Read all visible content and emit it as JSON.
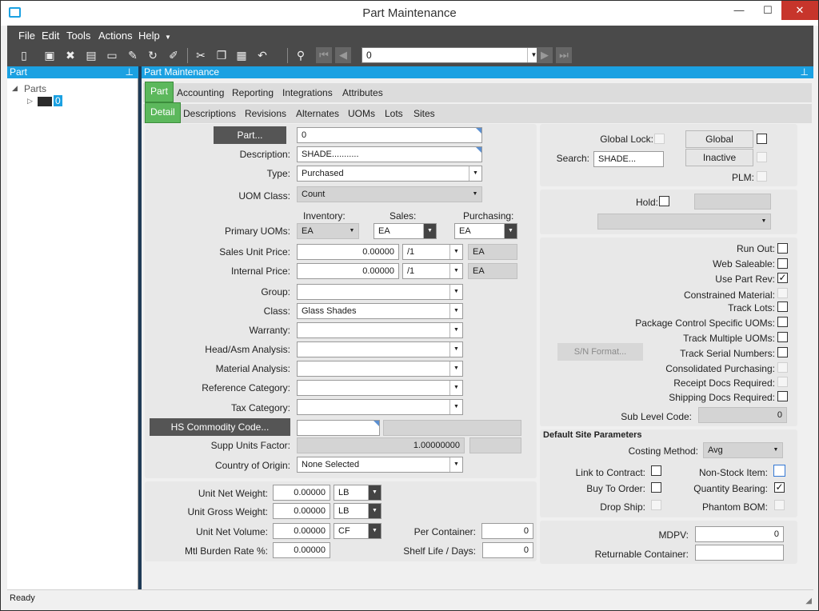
{
  "window": {
    "title": "Part Maintenance",
    "min": "—",
    "max": "☐",
    "close": "✕"
  },
  "menu": [
    "File",
    "Edit",
    "Tools",
    "Actions",
    "Help"
  ],
  "toolbar": {
    "record_value": "0"
  },
  "left_panel": {
    "header": "Part",
    "pin": "⊥",
    "tree_root": "Parts",
    "tree_child": "0"
  },
  "main_panel": {
    "header": "Part Maintenance",
    "pin": "⊥"
  },
  "tabs_top": [
    "Part",
    "Accounting",
    "Reporting",
    "Integrations",
    "Attributes"
  ],
  "tabs_sub": [
    "Detail",
    "Descriptions",
    "Revisions",
    "Alternates",
    "UOMs",
    "Lots",
    "Sites"
  ],
  "form": {
    "part_button": "Part...",
    "part_value": "0",
    "description_label": "Description:",
    "description_value": "SHADE...........",
    "type_label": "Type:",
    "type_value": "Purchased",
    "uom_class_label": "UOM Class:",
    "uom_class_value": "Count",
    "inventory_label": "Inventory:",
    "sales_label": "Sales:",
    "purchasing_label": "Purchasing:",
    "primary_uoms_label": "Primary UOMs:",
    "inv_uom": "EA",
    "sales_uom": "EA",
    "purch_uom": "EA",
    "sales_unit_price_label": "Sales Unit Price:",
    "sales_unit_price": "0.00000",
    "sales_per": "/1",
    "sales_price_uom": "EA",
    "internal_price_label": "Internal Price:",
    "internal_price": "0.00000",
    "internal_per": "/1",
    "internal_price_uom": "EA",
    "group_label": "Group:",
    "group_value": "",
    "class_label": "Class:",
    "class_value": "Glass Shades",
    "warranty_label": "Warranty:",
    "headasm_label": "Head/Asm Analysis:",
    "material_label": "Material Analysis:",
    "refcat_label": "Reference Category:",
    "taxcat_label": "Tax Category:",
    "hs_button": "HS Commodity Code...",
    "supp_units_label": "Supp Units Factor:",
    "supp_units_value": "1.00000000",
    "country_label": "Country of Origin:",
    "country_value": "None Selected",
    "unit_net_weight_label": "Unit Net Weight:",
    "unit_net_weight": "0.00000",
    "net_weight_uom": "LB",
    "unit_gross_weight_label": "Unit Gross Weight:",
    "unit_gross_weight": "0.00000",
    "gross_weight_uom": "LB",
    "unit_net_volume_label": "Unit Net Volume:",
    "unit_net_volume": "0.00000",
    "volume_uom": "CF",
    "mtl_burden_label": "Mtl Burden Rate %:",
    "mtl_burden": "0.00000",
    "per_container_label": "Per Container:",
    "per_container": "0",
    "shelf_life_label": "Shelf Life / Days:",
    "shelf_life": "0"
  },
  "right": {
    "global_lock_label": "Global Lock:",
    "global_button": "Global",
    "inactive_button": "Inactive",
    "search_label": "Search:",
    "search_value": "SHADE...",
    "plm_label": "PLM:",
    "hold_label": "Hold:",
    "run_out": "Run Out:",
    "web_saleable": "Web Saleable:",
    "use_part_rev": "Use Part Rev:",
    "constrained": "Constrained Material:",
    "track_lots": "Track Lots:",
    "pkg_control": "Package Control Specific UOMs:",
    "track_multi": "Track Multiple UOMs:",
    "track_serial": "Track Serial Numbers:",
    "consolidated": "Consolidated Purchasing:",
    "receipt_docs": "Receipt Docs Required:",
    "shipping_docs": "Shipping Docs Required:",
    "sn_format": "S/N Format...",
    "sub_level_label": "Sub Level Code:",
    "sub_level_value": "0",
    "default_site_header": "Default Site Parameters",
    "costing_label": "Costing Method:",
    "costing_value": "Avg",
    "link_contract": "Link to Contract:",
    "non_stock": "Non-Stock Item:",
    "buy_to_order": "Buy To Order:",
    "qty_bearing": "Quantity Bearing:",
    "drop_ship": "Drop Ship:",
    "phantom_bom": "Phantom BOM:",
    "mdpv_label": "MDPV:",
    "mdpv_value": "0",
    "returnable_label": "Returnable Container:",
    "returnable_value": ""
  },
  "checks": {
    "check_mark": "✓"
  },
  "status": {
    "text": "Ready"
  }
}
